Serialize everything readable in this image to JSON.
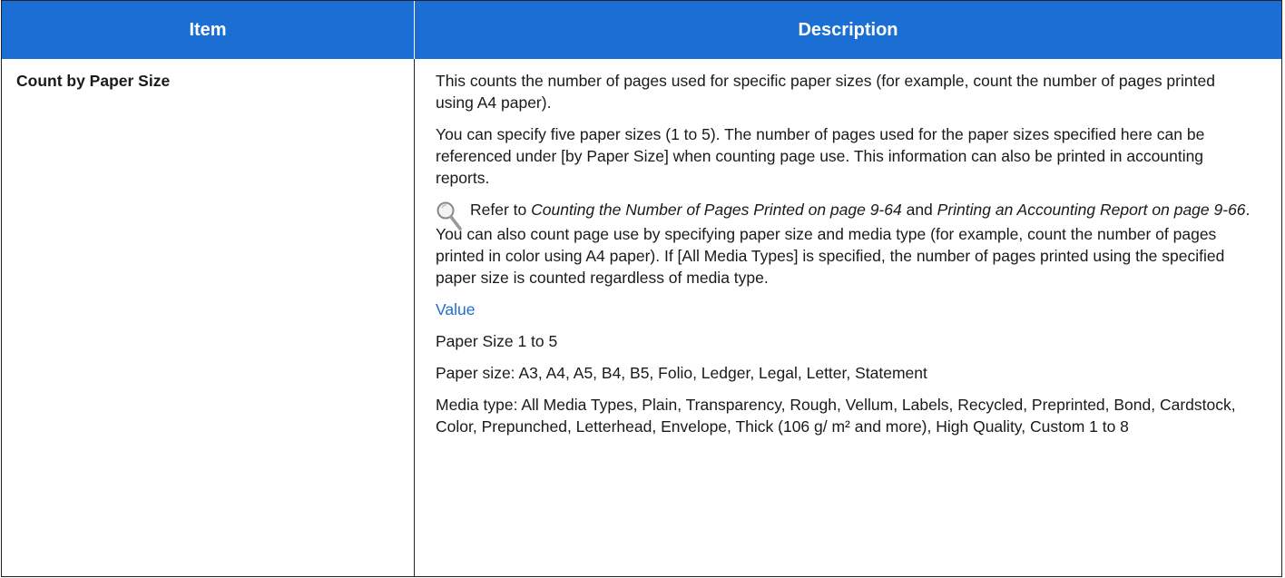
{
  "header": {
    "item": "Item",
    "description": "Description"
  },
  "row": {
    "item": "Count by Paper Size",
    "p1": "This counts the number of pages used for specific paper sizes (for example, count the number of pages printed using A4 paper).",
    "p2": "You can specify five paper sizes (1 to 5). The number of pages used for the paper sizes specified here can be referenced under [by Paper Size] when counting page use. This information can also be printed in accounting reports.",
    "ref": {
      "prefix": "Refer to ",
      "link1": "Counting the Number of Pages Printed on page 9-64",
      "mid": " and ",
      "link2": "Printing an Accounting Report on page 9-66",
      "suffix": "."
    },
    "p3": "You can also count page use by specifying paper size and media type (for example, count the number of pages printed in color using A4 paper). If [All Media Types] is specified, the number of pages printed using the specified paper size is counted regardless of media type.",
    "value_heading": "Value",
    "v1": "Paper Size 1 to 5",
    "v2": "Paper size: A3, A4, A5, B4, B5, Folio, Ledger, Legal, Letter, Statement",
    "v3": "Media type: All Media Types, Plain, Transparency, Rough, Vellum, Labels, Recycled, Preprinted, Bond, Cardstock, Color, Prepunched, Letterhead, Envelope, Thick (106 g/ m² and more), High Quality, Custom 1 to 8"
  },
  "icons": {
    "reference": "magnifier-icon"
  },
  "colors": {
    "header_bg": "#1b6fd4",
    "value_heading": "#1b6fd4"
  }
}
